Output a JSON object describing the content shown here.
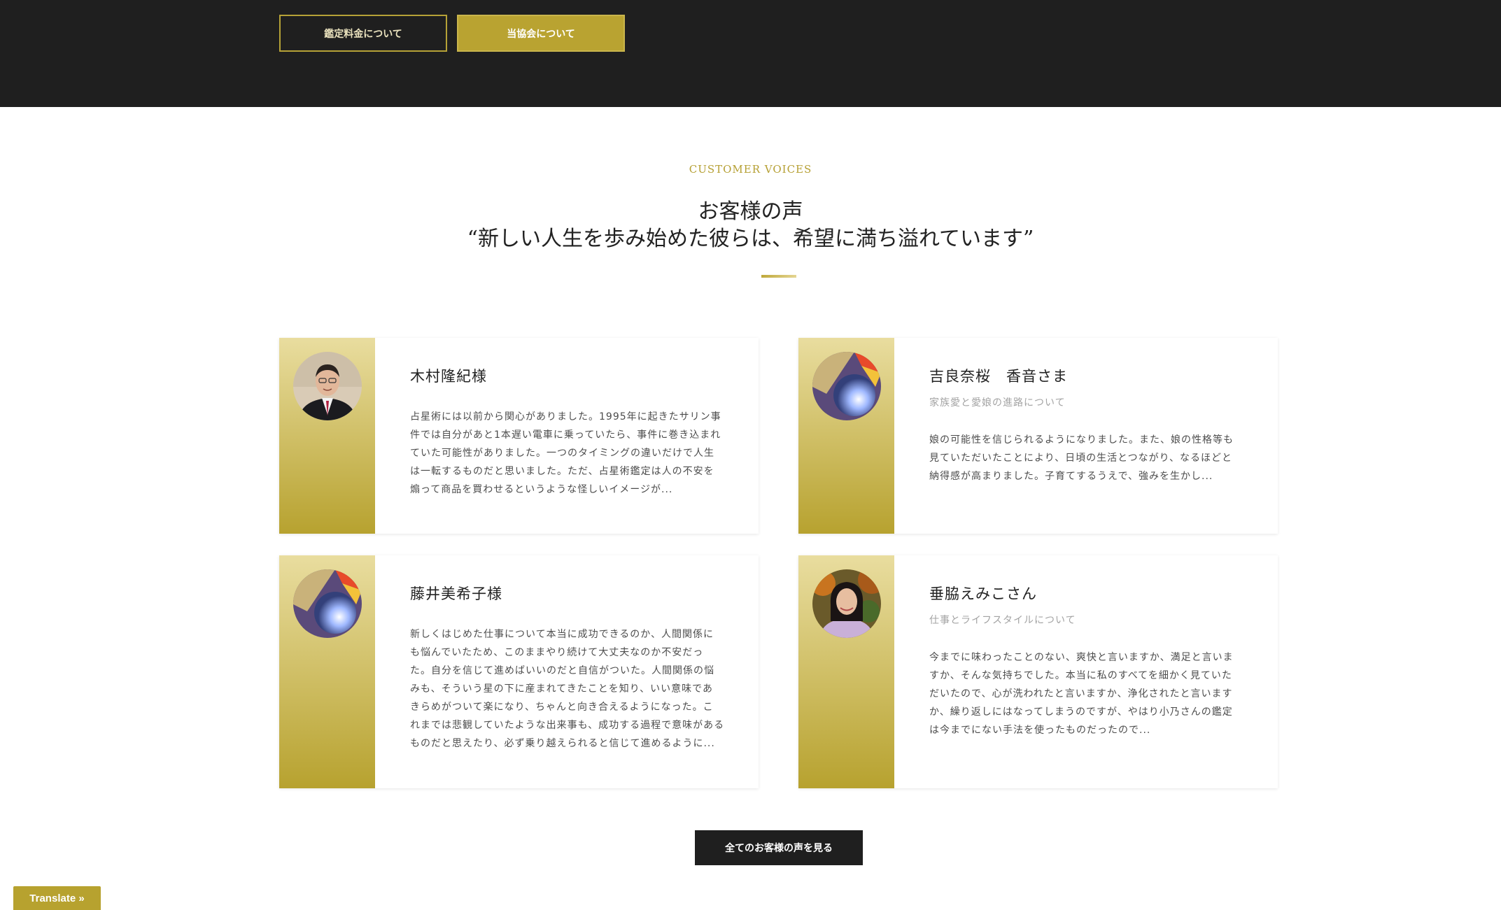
{
  "top_buttons": {
    "fee_label": "鑑定料金について",
    "about_label": "当協会について"
  },
  "section": {
    "eyebrow": "CUSTOMER VOICES",
    "title_line1": "お客様の声",
    "title_line2": "“新しい人生を歩み始めた彼らは、希望に満ち溢れています”"
  },
  "testimonials": [
    {
      "name": "木村隆紀様",
      "subtitle": "",
      "lines": [
        "占星術には以前から関心がありました。1995年に起きたサリン事",
        "件では自分があと1本遅い電車に乗っていたら、事件に巻き込まれ",
        "ていた可能性がありました。一つのタイミングの違いだけで人生",
        "は一転するものだと思いました。ただ、占星術鑑定は人の不安を",
        "煽って商品を買わせるというような怪しいイメージが..."
      ]
    },
    {
      "name": "吉良奈桜　香音さま",
      "subtitle": "家族愛と愛娘の進路について",
      "lines": [
        "娘の可能性を信じられるようになりました。また、娘の性格等も",
        "見ていただいたことにより、日頃の生活とつながり、なるほどと",
        "納得感が高まりました。子育てするうえで、強みを生かし..."
      ]
    },
    {
      "name": "藤井美希子様",
      "subtitle": "",
      "lines": [
        "新しくはじめた仕事について本当に成功できるのか、人間関係に",
        "も悩んでいたため、このままやり続けて大丈夫なのか不安だっ",
        "た。自分を信じて進めばいいのだと自信がついた。人間関係の悩",
        "みも、そういう星の下に産まれてきたことを知り、いい意味であ",
        "きらめがついて楽になり、ちゃんと向き合えるようになった。こ",
        "れまでは悲観していたような出来事も、成功する過程で意味がある",
        "ものだと思えたり、必ず乗り越えられると信じて進めるように..."
      ]
    },
    {
      "name": "垂脇えみこさん",
      "subtitle": "仕事とライフスタイルについて",
      "lines": [
        "今までに味わったことのない、爽快と言いますか、満足と言いま",
        "すか、そんな気持ちでした。本当に私のすべてを細かく見ていた",
        "だいたので、心が洗われたと言いますか、浄化されたと言います",
        "か、繰り返しにはなってしまうのですが、やはり小乃さんの鑑定",
        "は今までにない手法を使ったものだったので..."
      ]
    }
  ],
  "view_all_label": "全てのお客様の声を見る",
  "translate_label": "Translate »",
  "colors": {
    "gold": "#b7a22f",
    "dark": "#1f1f1f"
  }
}
